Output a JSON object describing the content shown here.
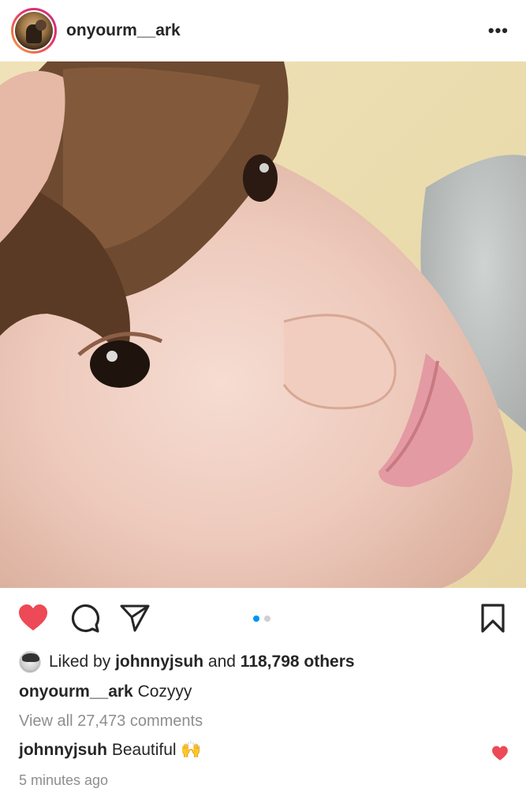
{
  "post": {
    "username": "onyourm__ark",
    "more_label": "•••",
    "liked_by_prefix": "Liked by",
    "liked_by_user": "johnnyjsuh",
    "liked_by_and": "and",
    "likes_count": "118,798 others",
    "caption_user": "onyourm__ark",
    "caption_text": "Cozyyy",
    "view_comments": "View all 27,473 comments",
    "comment_user": "johnnyjsuh",
    "comment_text": "Beautiful",
    "comment_emoji": "🙌",
    "timestamp": "5 minutes ago"
  },
  "carousel": {
    "current": 1,
    "total": 2
  },
  "state": {
    "liked": true,
    "comment_liked": true
  },
  "icons": {
    "like": "heart-icon",
    "comment": "comment-icon",
    "share": "send-icon",
    "save": "bookmark-icon",
    "more": "more-dots-icon"
  },
  "colors": {
    "like_red": "#ed4956",
    "accent_blue": "#0095f6",
    "muted": "#8e8e8e"
  }
}
